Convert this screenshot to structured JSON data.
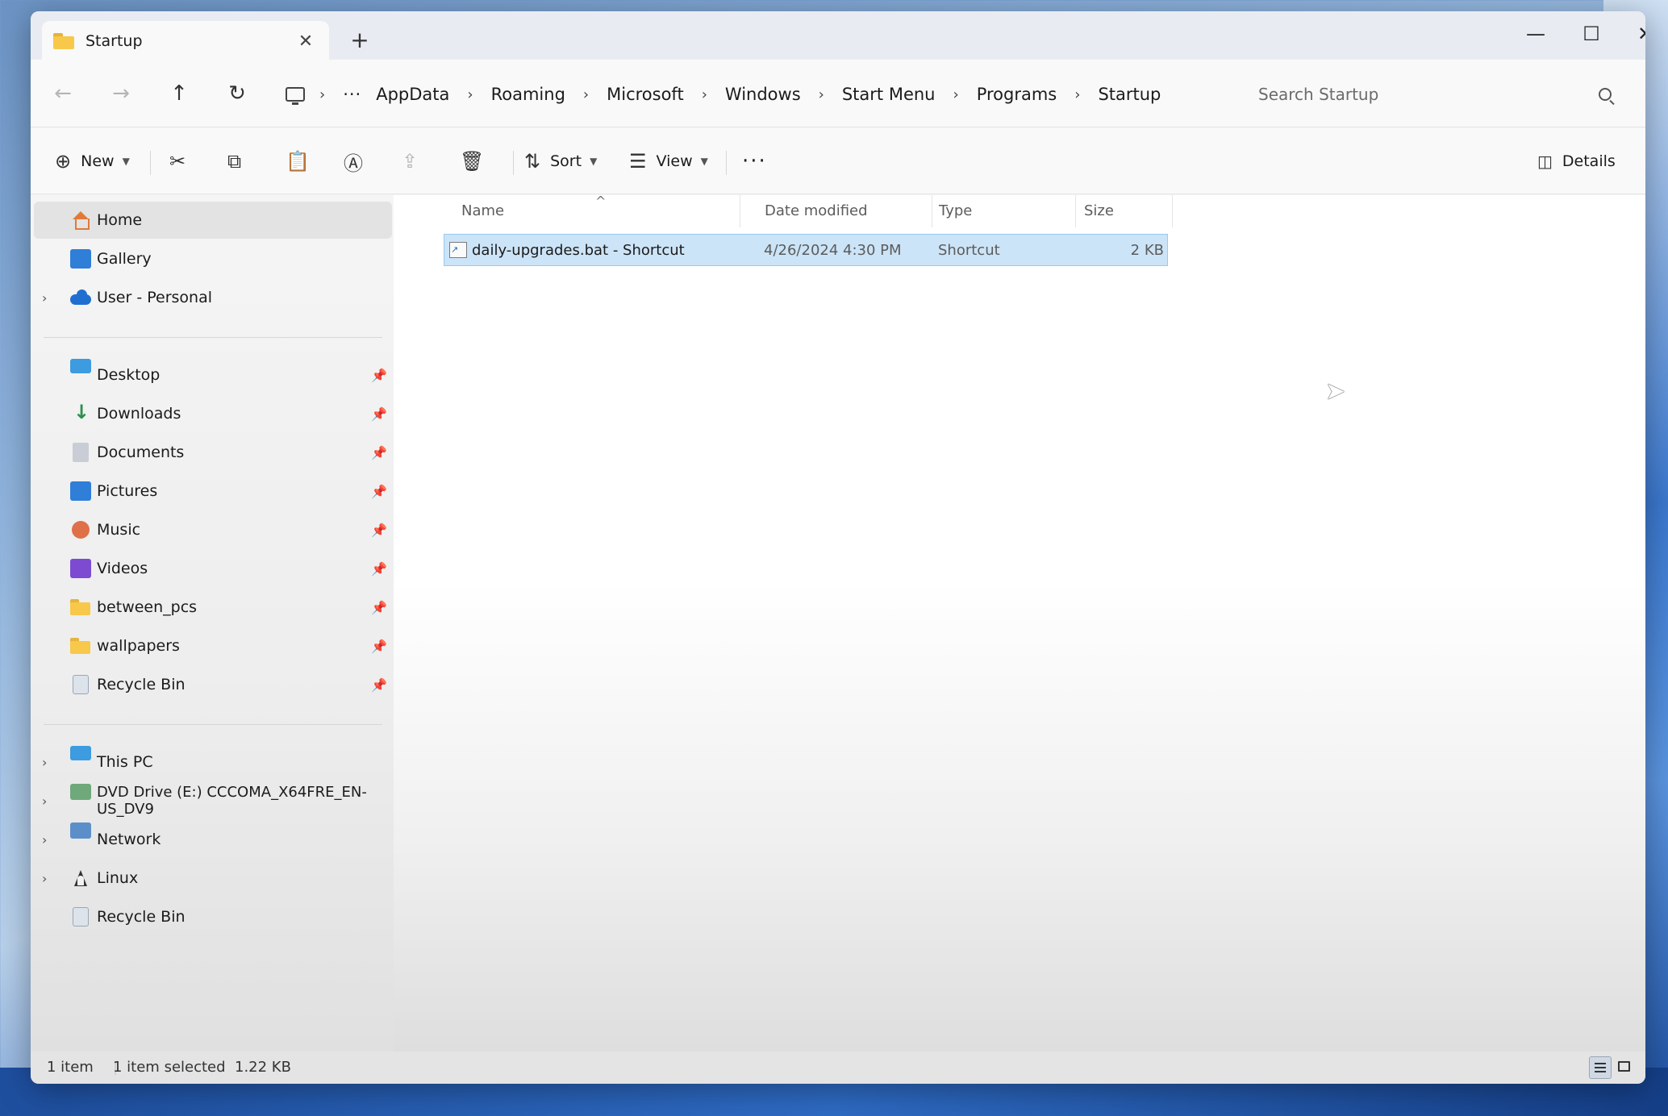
{
  "window": {
    "tab_title": "Startup",
    "new_tab": "+",
    "close_tab": "✕",
    "controls": {
      "minimize": "—",
      "maximize": "☐",
      "close": "✕"
    }
  },
  "nav": {
    "back": "←",
    "forward": "→",
    "up": "↑",
    "refresh": "↻"
  },
  "breadcrumb": {
    "more": "···",
    "separator": "›",
    "items": [
      "AppData",
      "Roaming",
      "Microsoft",
      "Windows",
      "Start Menu",
      "Programs",
      "Startup"
    ]
  },
  "search": {
    "placeholder": "Search Startup"
  },
  "commandbar": {
    "new_label": "New",
    "sort_label": "Sort",
    "view_label": "View",
    "more": "···",
    "details_label": "Details",
    "icons": [
      "plus-circle-icon",
      "cut-icon",
      "copy-icon",
      "paste-icon",
      "rename-icon",
      "share-icon",
      "delete-icon",
      "sort-icon",
      "view-icon"
    ]
  },
  "sidebar": {
    "top": [
      {
        "label": "Home",
        "icon": "home-icon",
        "expandable": false,
        "selected": true
      },
      {
        "label": "Gallery",
        "icon": "gallery-icon",
        "expandable": false
      },
      {
        "label": "User - Personal",
        "icon": "cloud-icon",
        "expandable": true
      }
    ],
    "pinned": [
      {
        "label": "Desktop",
        "icon": "desktop-icon"
      },
      {
        "label": "Downloads",
        "icon": "downloads-icon"
      },
      {
        "label": "Documents",
        "icon": "documents-icon"
      },
      {
        "label": "Pictures",
        "icon": "pictures-icon"
      },
      {
        "label": "Music",
        "icon": "music-icon"
      },
      {
        "label": "Videos",
        "icon": "videos-icon"
      },
      {
        "label": "between_pcs",
        "icon": "folder-icon"
      },
      {
        "label": "wallpapers",
        "icon": "folder-icon"
      },
      {
        "label": "Recycle Bin",
        "icon": "recycle-bin-icon"
      }
    ],
    "locations": [
      {
        "label": "This PC",
        "icon": "this-pc-icon",
        "expandable": true
      },
      {
        "label": "DVD Drive (E:) CCCOMA_X64FRE_EN-US_DV9",
        "icon": "dvd-drive-icon",
        "expandable": true
      },
      {
        "label": "Network",
        "icon": "network-icon",
        "expandable": true
      },
      {
        "label": "Linux",
        "icon": "linux-icon",
        "expandable": true
      },
      {
        "label": "Recycle Bin",
        "icon": "recycle-bin-icon",
        "expandable": false
      }
    ]
  },
  "columns": {
    "name": "Name",
    "date": "Date modified",
    "type": "Type",
    "size": "Size"
  },
  "files": [
    {
      "name": "daily-upgrades.bat - Shortcut",
      "date": "4/26/2024 4:30 PM",
      "type": "Shortcut",
      "size": "2 KB",
      "selected": true
    }
  ],
  "status": {
    "count": "1 item",
    "selection": "1 item selected  1.22 KB"
  }
}
